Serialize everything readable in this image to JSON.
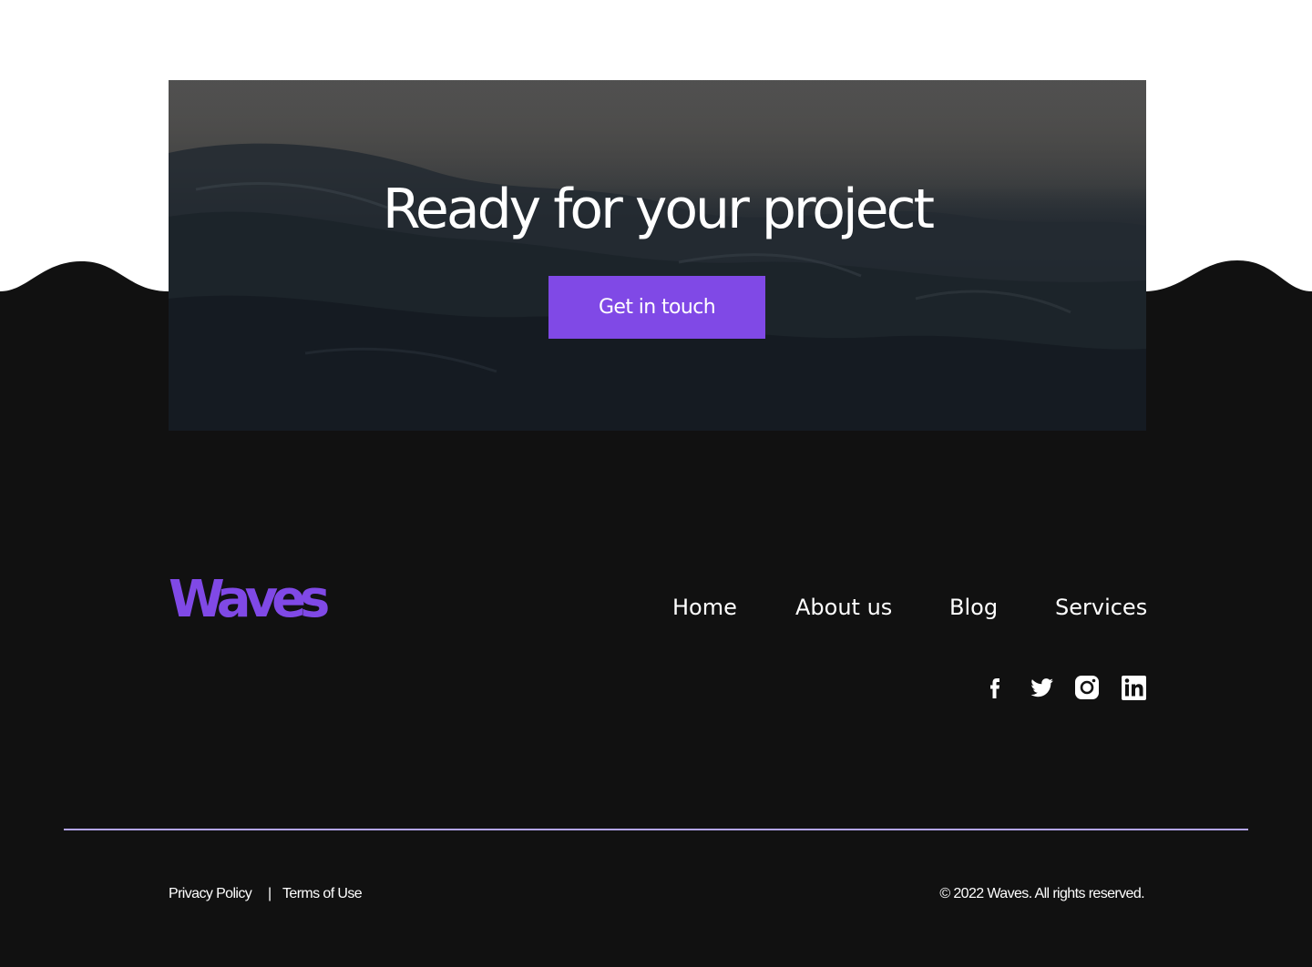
{
  "cta": {
    "title": "Ready for your project",
    "button_label": "Get in touch"
  },
  "footer": {
    "logo": "Waves",
    "nav": {
      "home": "Home",
      "about": "About us",
      "blog": "Blog",
      "services": "Services"
    },
    "social": [
      "facebook-icon",
      "twitter-icon",
      "instagram-icon",
      "linkedin-icon"
    ],
    "legal": {
      "privacy": "Privacy Policy",
      "separator": "|",
      "terms": "Terms of Use",
      "copyright": "© 2022 Waves. All rights reserved."
    }
  },
  "colors": {
    "accent": "#8049e6",
    "footer_bg": "#111111",
    "divider": "#b3a5f0",
    "text": "#ffffff"
  }
}
